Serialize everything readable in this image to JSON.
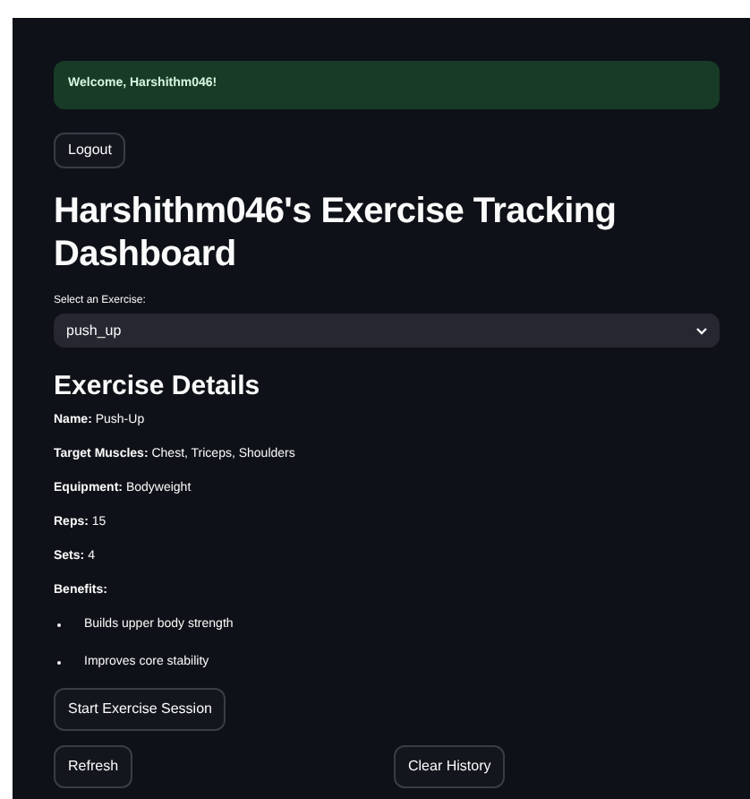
{
  "banner": {
    "text": "Welcome, Harshithm046!"
  },
  "logout_button": "Logout",
  "title": "Harshithm046's Exercise Tracking Dashboard",
  "exercise_select": {
    "label": "Select an Exercise:",
    "value": "push_up"
  },
  "details": {
    "heading": "Exercise Details",
    "fields": [
      {
        "label": "Name:",
        "value": "Push-Up"
      },
      {
        "label": "Target Muscles:",
        "value": "Chest, Triceps, Shoulders"
      },
      {
        "label": "Equipment:",
        "value": "Bodyweight"
      },
      {
        "label": "Reps:",
        "value": "15"
      },
      {
        "label": "Sets:",
        "value": "4"
      },
      {
        "label": "Benefits:"
      }
    ],
    "benefits": [
      "Builds upper body strength",
      "Improves core stability"
    ]
  },
  "start_button": "Start Exercise Session",
  "bottom_buttons": [
    "Refresh",
    "Clear History"
  ]
}
